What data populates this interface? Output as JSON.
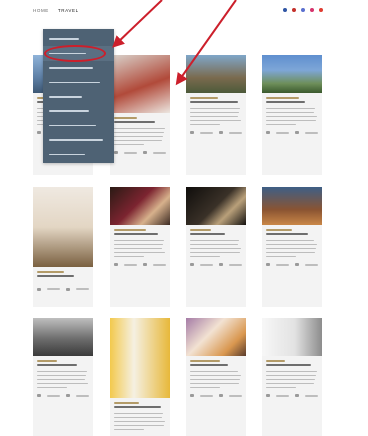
{
  "nav": {
    "items": [
      {
        "label": "HOME"
      },
      {
        "label": "TRAVEL",
        "active": true
      },
      {
        "label": ""
      },
      {
        "label": ""
      },
      {
        "label": ""
      },
      {
        "label": ""
      },
      {
        "label": ""
      }
    ],
    "social_colors": [
      "#2f55a4",
      "#c4302b",
      "#5a6fcf",
      "#d6336c",
      "#e03c31"
    ]
  },
  "dropdown": {
    "items": [
      {
        "label": ""
      },
      {
        "label": "",
        "highlighted": true
      },
      {
        "label": ""
      },
      {
        "label": ""
      },
      {
        "label": ""
      },
      {
        "label": ""
      },
      {
        "label": ""
      },
      {
        "label": ""
      },
      {
        "label": ""
      }
    ]
  },
  "colors": {
    "dropdown_bg": "#4e6274",
    "annotation_red": "#cc1f2b",
    "card_bg": "#f3f3f3",
    "accent_text": "#b39b68"
  },
  "cards": [
    {
      "row": 0,
      "col": 0
    },
    {
      "row": 0,
      "col": 1
    },
    {
      "row": 0,
      "col": 2
    },
    {
      "row": 0,
      "col": 3
    },
    {
      "row": 0,
      "col": 4
    },
    {
      "row": 1,
      "col": 0
    },
    {
      "row": 1,
      "col": 1
    },
    {
      "row": 1,
      "col": 2
    },
    {
      "row": 1,
      "col": 3
    },
    {
      "row": 1,
      "col": 4
    },
    {
      "row": 2,
      "col": 0
    },
    {
      "row": 2,
      "col": 1
    },
    {
      "row": 2,
      "col": 2
    },
    {
      "row": 2,
      "col": 3
    },
    {
      "row": 2,
      "col": 4
    }
  ]
}
